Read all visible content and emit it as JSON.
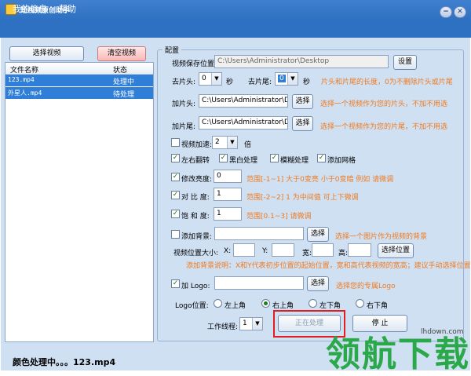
{
  "window": {
    "title": "短视频原创助手",
    "min_label": "−",
    "close_label": "✕"
  },
  "menu": {
    "items": [
      "我的信息",
      "帮助"
    ]
  },
  "left": {
    "select_button": "选择视频",
    "clear_button": "清空视频",
    "columns": [
      "文件名称",
      "状态"
    ],
    "rows": [
      {
        "name": "123.mp4",
        "status": "处理中"
      },
      {
        "name": "外星人.mp4",
        "status": "待处理"
      }
    ]
  },
  "config": {
    "group_label": "配置",
    "save_path_label": "视频保存位置:",
    "save_path_value": "C:\\Users\\Administrator\\Desktop",
    "settings_button": "设置",
    "trim_head_label": "去片头:",
    "trim_head_value": "0",
    "trim_unit1": "秒",
    "trim_tail_label": "去片尾:",
    "trim_tail_value": "0",
    "trim_unit2": "秒",
    "trim_hint": "片头和片尾的长度，0为不删除片头或片尾",
    "add_head_label": "加片头:",
    "add_head_value": "C:\\Users\\Administrator\\Des",
    "choose1": "选择",
    "add_head_hint": "选择一个视频作为您的片头，不加不用选",
    "add_tail_label": "加片尾:",
    "add_tail_value": "C:\\Users\\Administrator\\Des",
    "choose2": "选择",
    "add_tail_hint": "选择一个视频作为您的片尾，不加不用选",
    "speed_label": "视频加速:",
    "speed_value": "2",
    "speed_unit": "倍",
    "flip_label": "左右翻转",
    "bw_label": "黑白处理",
    "blur_label": "模糊处理",
    "grid_label": "添加网格",
    "brightness_label": "修改亮度:",
    "brightness_value": "0",
    "brightness_hint": "范围[-1~1]   大于0变亮 小于0变暗  例如 请微调",
    "contrast_label": "对 比 度:",
    "contrast_value": "1",
    "contrast_hint": "范围[-2~2]  1 为中间值  可上下微调",
    "saturation_label": "饱 和 度:",
    "saturation_value": "1",
    "saturation_hint": "范围[0.1~3]  请微调",
    "bg_label": "添加背景:",
    "choose3": "选择",
    "bg_hint": "选择一个图片作为视频的背景",
    "pos_label": "视频位置大小:",
    "x_label": "X:",
    "y_label": "Y:",
    "w_label": "宽:",
    "h_label": "高:",
    "choose_pos": "选择位置",
    "bg_note": "添加背景说明：X和Y代表初步位置的起始位置，宽和高代表视频的宽高；建议手动选择位置",
    "logo_label": "加 Logo:",
    "choose4": "选择",
    "logo_hint": "选择您的专属Logo",
    "logo_pos_label": "Logo位置:",
    "logo_positions": [
      "左上角",
      "右上角",
      "左下角",
      "右下角"
    ],
    "threads_label": "工作线程:",
    "threads_value": "1",
    "processing_button": "正在处理",
    "stop_button": "停  止"
  },
  "status": {
    "text": "颜色处理中。。。123.mp4"
  },
  "watermark": {
    "text": "领航下载",
    "url": "lhdown.com"
  },
  "colors": {
    "accent": "#2e70c2",
    "hint": "#ef7a1e",
    "selection": "#2f7fd8"
  }
}
